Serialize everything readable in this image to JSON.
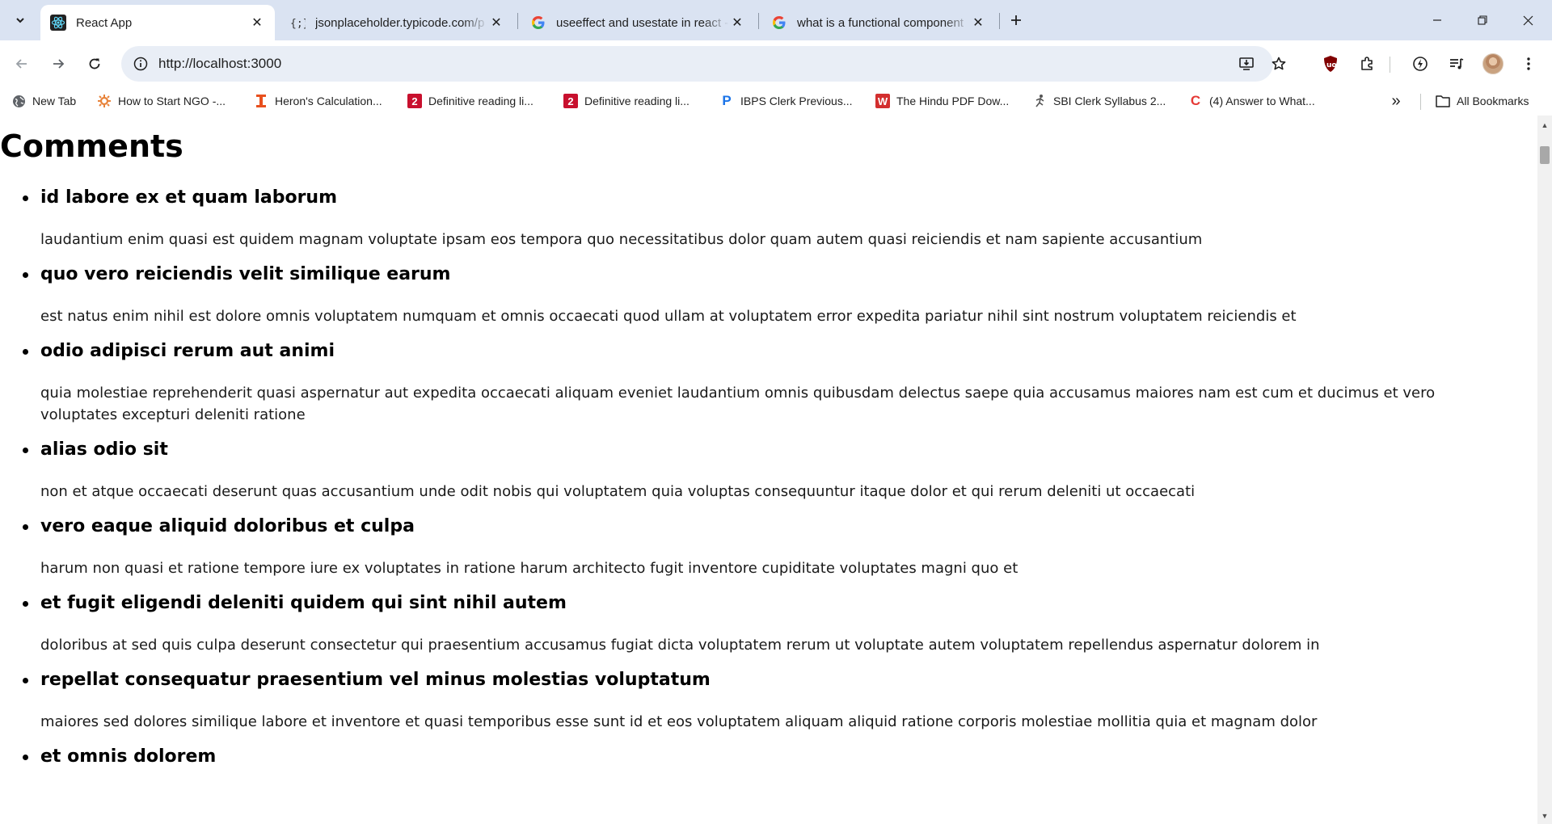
{
  "browser": {
    "tabs": [
      {
        "title": "React App",
        "favicon": "react-icon",
        "active": true
      },
      {
        "title": "jsonplaceholder.typicode.com/p",
        "favicon": "jsonplaceholder-icon",
        "active": false
      },
      {
        "title": "useeffect and usestate in react -",
        "favicon": "google-icon",
        "active": false
      },
      {
        "title": "what is a functional component",
        "favicon": "google-icon",
        "active": false
      }
    ],
    "address_bar": {
      "url": "http://localhost:3000"
    },
    "bookmarks": [
      {
        "label": "New Tab",
        "icon": "globe-icon",
        "color": "#5f6368"
      },
      {
        "label": "How to Start NGO -...",
        "icon": "gear-flower-icon",
        "color": "#e8833a"
      },
      {
        "label": "Heron's Calculation...",
        "icon": "orange-i-icon",
        "color": "#e8501e"
      },
      {
        "label": "Definitive reading li...",
        "icon": "red-2-icon",
        "color": "#c8102e"
      },
      {
        "label": "Definitive reading li...",
        "icon": "red-2-icon",
        "color": "#c8102e"
      },
      {
        "label": "IBPS Clerk Previous...",
        "icon": "blue-p-icon",
        "color": "#1a73e8"
      },
      {
        "label": "The Hindu PDF Dow...",
        "icon": "red-w-icon",
        "color": "#d32f2f"
      },
      {
        "label": "SBI Clerk Syllabus 2...",
        "icon": "runner-icon",
        "color": "#555555"
      },
      {
        "label": "(4) Answer to What...",
        "icon": "chegg-icon",
        "color": "#e53935"
      }
    ],
    "all_bookmarks_label": "All Bookmarks"
  },
  "page": {
    "title": "Comments",
    "comments": [
      {
        "name": "id labore ex et quam laborum",
        "body": "laudantium enim quasi est quidem magnam voluptate ipsam eos tempora quo necessitatibus dolor quam autem quasi reiciendis et nam sapiente accusantium"
      },
      {
        "name": "quo vero reiciendis velit similique earum",
        "body": "est natus enim nihil est dolore omnis voluptatem numquam et omnis occaecati quod ullam at voluptatem error expedita pariatur nihil sint nostrum voluptatem reiciendis et"
      },
      {
        "name": "odio adipisci rerum aut animi",
        "body": "quia molestiae reprehenderit quasi aspernatur aut expedita occaecati aliquam eveniet laudantium omnis quibusdam delectus saepe quia accusamus maiores nam est cum et ducimus et vero voluptates excepturi deleniti ratione"
      },
      {
        "name": "alias odio sit",
        "body": "non et atque occaecati deserunt quas accusantium unde odit nobis qui voluptatem quia voluptas consequuntur itaque dolor et qui rerum deleniti ut occaecati"
      },
      {
        "name": "vero eaque aliquid doloribus et culpa",
        "body": "harum non quasi et ratione tempore iure ex voluptates in ratione harum architecto fugit inventore cupiditate voluptates magni quo et"
      },
      {
        "name": "et fugit eligendi deleniti quidem qui sint nihil autem",
        "body": "doloribus at sed quis culpa deserunt consectetur qui praesentium accusamus fugiat dicta voluptatem rerum ut voluptate autem voluptatem repellendus aspernatur dolorem in"
      },
      {
        "name": "repellat consequatur praesentium vel minus molestias voluptatum",
        "body": "maiores sed dolores similique labore et inventore et quasi temporibus esse sunt id et eos voluptatem aliquam aliquid ratione corporis molestiae mollitia quia et magnam dolor"
      },
      {
        "name": "et omnis dolorem",
        "body": ""
      }
    ]
  }
}
